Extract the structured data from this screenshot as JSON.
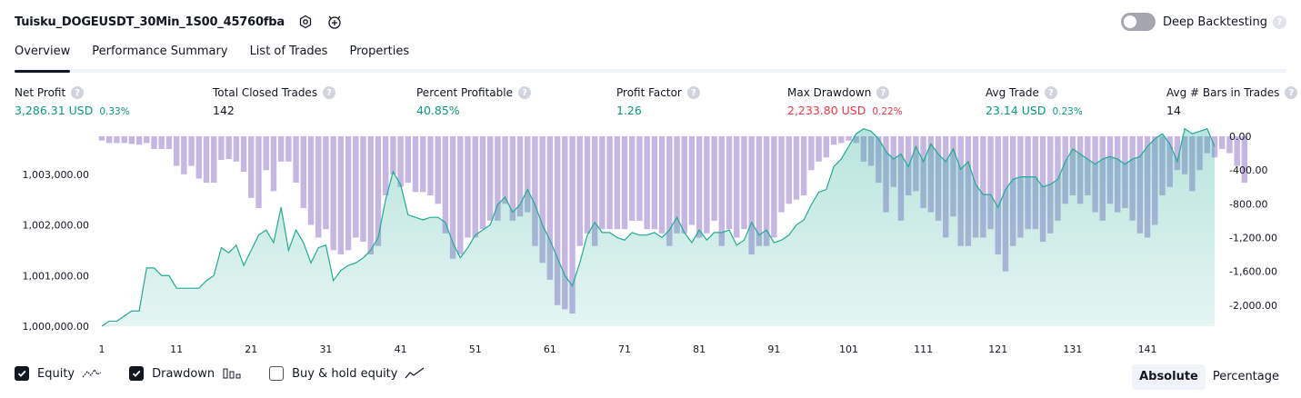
{
  "header": {
    "title": "Tuisku_DOGEUSDT_30Min_1S00_45760fba",
    "settings_icon": "settings-icon",
    "alert_icon": "add-alert-icon",
    "deep_backtesting_label": "Deep Backtesting",
    "deep_backtesting_enabled": false,
    "help_glyph": "?"
  },
  "tabs": [
    {
      "label": "Overview",
      "active": true
    },
    {
      "label": "Performance Summary",
      "active": false
    },
    {
      "label": "List of Trades",
      "active": false
    },
    {
      "label": "Properties",
      "active": false
    }
  ],
  "metrics": [
    {
      "label": "Net Profit",
      "value": "3,286.31 USD",
      "pct": "0.33%",
      "color": "#089981"
    },
    {
      "label": "Total Closed Trades",
      "value": "142",
      "pct": "",
      "color": "#131722"
    },
    {
      "label": "Percent Profitable",
      "value": "40.85%",
      "pct": "",
      "color": "#089981"
    },
    {
      "label": "Profit Factor",
      "value": "1.26",
      "pct": "",
      "color": "#089981"
    },
    {
      "label": "Max Drawdown",
      "value": "2,233.80 USD",
      "pct": "0.22%",
      "color": "#f23645"
    },
    {
      "label": "Avg Trade",
      "value": "23.14 USD",
      "pct": "0.23%",
      "color": "#089981"
    },
    {
      "label": "Avg # Bars in Trades",
      "value": "14",
      "pct": "",
      "color": "#131722"
    }
  ],
  "chart_data": {
    "type": "line+bar",
    "x_ticks": [
      "1",
      "11",
      "21",
      "31",
      "41",
      "51",
      "61",
      "71",
      "81",
      "91",
      "101",
      "111",
      "121",
      "131",
      "141"
    ],
    "y_left_ticks": [
      "1,003,000.00",
      "1,002,000.00",
      "1,001,000.00",
      "1,000,000.00"
    ],
    "y_right_ticks": [
      "0.00",
      "-400.00",
      "-800.00",
      "-1,200.00",
      "-1,600.00",
      "-2,000.00"
    ],
    "series": [
      {
        "name": "Equity",
        "color": "#22ab94",
        "type": "area",
        "values": [
          1000000,
          1000100,
          1000100,
          1000200,
          1000300,
          1000300,
          1001150,
          1001150,
          1001000,
          1001000,
          1000750,
          1000750,
          1000750,
          1000750,
          1000900,
          1001000,
          1001550,
          1001450,
          1001600,
          1001200,
          1001500,
          1001800,
          1001900,
          1001650,
          1002350,
          1001500,
          1001900,
          1001650,
          1001250,
          1001550,
          1001600,
          1000900,
          1001100,
          1001200,
          1001250,
          1001350,
          1001500,
          1001750,
          1002500,
          1003050,
          1002800,
          1002200,
          1002150,
          1002100,
          1002150,
          1002150,
          1002050,
          1001650,
          1001350,
          1001550,
          1001800,
          1001900,
          1002000,
          1002400,
          1002550,
          1002250,
          1002400,
          1002700,
          1002400,
          1002000,
          1001700,
          1001350,
          1001000,
          1000800,
          1001250,
          1001800,
          1002050,
          1001850,
          1001850,
          1001750,
          1001700,
          1001850,
          1001800,
          1001800,
          1001850,
          1001750,
          1001900,
          1002150,
          1001850,
          1001650,
          1001900,
          1001700,
          1001850,
          1001850,
          1001900,
          1001600,
          1001700,
          1002050,
          1001800,
          1001900,
          1001650,
          1001700,
          1001800,
          1002000,
          1002100,
          1002400,
          1002650,
          1002700,
          1003150,
          1003300,
          1003550,
          1003800,
          1003900,
          1003850,
          1003700,
          1003450,
          1003300,
          1003400,
          1003150,
          1003550,
          1003250,
          1003600,
          1003400,
          1003250,
          1003500,
          1003100,
          1003250,
          1002800,
          1002600,
          1002600,
          1002350,
          1002700,
          1002900,
          1002950,
          1002950,
          1002950,
          1002750,
          1002800,
          1002900,
          1003250,
          1003500,
          1003400,
          1003300,
          1003200,
          1003300,
          1003350,
          1003300,
          1003200,
          1003300,
          1003350,
          1003550,
          1003700,
          1003800,
          1003600,
          1003250,
          1003900,
          1003800,
          1003850,
          1003900,
          1003550
        ]
      },
      {
        "name": "Drawdown",
        "color": "#b39ddb",
        "type": "bar",
        "values": [
          -50,
          -80,
          -80,
          -80,
          -90,
          -100,
          -80,
          -150,
          -150,
          -150,
          -350,
          -450,
          -350,
          -500,
          -550,
          -550,
          -280,
          -270,
          -300,
          -420,
          -730,
          -850,
          -400,
          -650,
          -300,
          -300,
          -550,
          -850,
          -1050,
          -1200,
          -1100,
          -1350,
          -1400,
          -1350,
          -1200,
          -1250,
          -1400,
          -1300,
          -700,
          -450,
          -600,
          -550,
          -660,
          -660,
          -700,
          -800,
          -1150,
          -1450,
          -1400,
          -1200,
          -1200,
          -1100,
          -1000,
          -1000,
          -800,
          -1000,
          -950,
          -900,
          -1300,
          -1500,
          -1700,
          -2000,
          -2050,
          -2100,
          -1300,
          -1150,
          -1300,
          -1100,
          -1100,
          -1100,
          -1100,
          -1000,
          -1000,
          -1100,
          -1100,
          -1150,
          -1300,
          -1150,
          -1150,
          -1050,
          -1200,
          -1150,
          -1000,
          -1300,
          -1100,
          -1200,
          -1100,
          -1400,
          -1300,
          -1300,
          -1200,
          -900,
          -800,
          -750,
          -700,
          -400,
          -300,
          -250,
          -100,
          -80,
          -50,
          -80,
          -300,
          -350,
          -550,
          -900,
          -600,
          -1000,
          -700,
          -650,
          -850,
          -900,
          -1000,
          -1200,
          -950,
          -1300,
          -1300,
          -1200,
          -1200,
          -1100,
          -1400,
          -1600,
          -1300,
          -1200,
          -1100,
          -1100,
          -1250,
          -1150,
          -1000,
          -800,
          -700,
          -800,
          -700,
          -900,
          -1000,
          -800,
          -900,
          -850,
          -1000,
          -1150,
          -1200,
          -1050,
          -700,
          -600,
          -400,
          -450,
          -650,
          -400,
          -200,
          -250,
          -150,
          -200,
          -350,
          -550
        ]
      }
    ],
    "legend": [
      {
        "label": "Equity",
        "checked": true
      },
      {
        "label": "Drawdown",
        "checked": true
      },
      {
        "label": "Buy & hold equity",
        "checked": false
      }
    ],
    "y_left_range": [
      1000000,
      1003750
    ],
    "y_right_range": [
      -2250,
      0
    ]
  },
  "mode_buttons": [
    {
      "label": "Absolute",
      "active": true
    },
    {
      "label": "Percentage",
      "active": false
    }
  ]
}
